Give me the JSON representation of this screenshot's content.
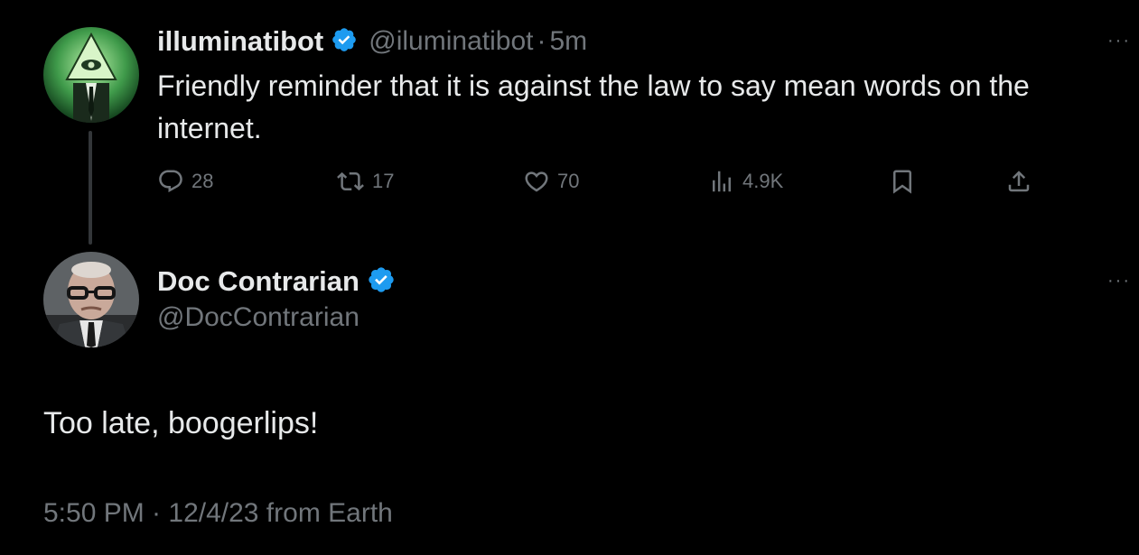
{
  "colors": {
    "background": "#000000",
    "primary_text": "#e7e9ea",
    "secondary_text": "#71767b",
    "verified_badge": "#1d9bf0",
    "thread_line": "#333639"
  },
  "parent_tweet": {
    "author_name": "illuminatibot",
    "author_handle": "@iluminatibot",
    "separator": "·",
    "time_ago": "5m",
    "text": "Friendly reminder that it is against the law to say mean words on the internet.",
    "avatar_icon": "all-seeing-eye-pyramid-avatar",
    "actions": {
      "reply_count": "28",
      "retweet_count": "17",
      "like_count": "70",
      "view_count": "4.9K"
    }
  },
  "reply_tweet": {
    "author_name": "Doc Contrarian",
    "author_handle": "@DocContrarian",
    "avatar_icon": "elderly-man-glasses-avatar",
    "text": "Too late, boogerlips!",
    "timestamp_line": "5:50 PM · 12/4/23 from Earth"
  },
  "more_label": "···"
}
